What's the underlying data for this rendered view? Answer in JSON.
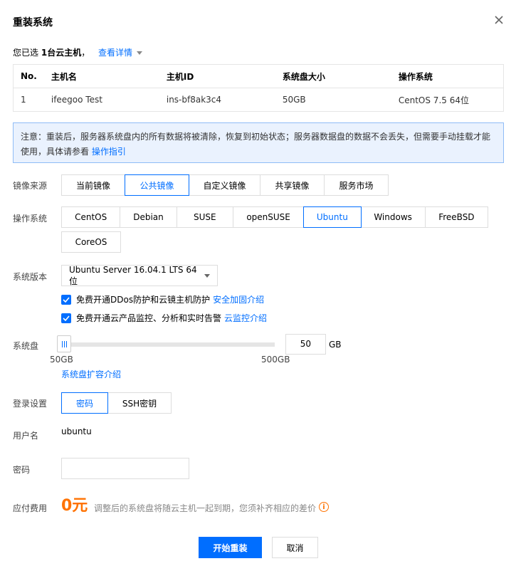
{
  "dialog": {
    "title": "重装系统",
    "close_icon": "close-icon"
  },
  "selection": {
    "prefix": "您已选",
    "count": "1台云主机",
    "separator": "，",
    "detail_link": "查看详情"
  },
  "table": {
    "headers": [
      "No.",
      "主机名",
      "主机ID",
      "系统盘大小",
      "操作系统"
    ],
    "rows": [
      [
        "1",
        "ifeegoo Test",
        "ins-bf8ak3c4",
        "50GB",
        "CentOS 7.5 64位"
      ]
    ]
  },
  "notice": {
    "text": "注意：重装后，服务器系统盘内的所有数据将被清除，恢复到初始状态；服务器数据盘的数据不会丢失，但需要手动挂载才能使用，具体请参看",
    "link": "操作指引"
  },
  "image_source": {
    "label": "镜像来源",
    "options": [
      "当前镜像",
      "公共镜像",
      "自定义镜像",
      "共享镜像",
      "服务市场"
    ],
    "selected": "公共镜像"
  },
  "os": {
    "label": "操作系统",
    "options_row1": [
      "CentOS",
      "Debian",
      "SUSE",
      "openSUSE",
      "Ubuntu",
      "Windows",
      "FreeBSD"
    ],
    "options_row2": [
      "CoreOS"
    ],
    "selected": "Ubuntu"
  },
  "version": {
    "label": "系统版本",
    "value": "Ubuntu Server 16.04.1 LTS 64位"
  },
  "checks": [
    {
      "text": "免费开通DDos防护和云镜主机防护",
      "link": "安全加固介绍",
      "checked": true
    },
    {
      "text": "免费开通云产品监控、分析和实时告警",
      "link": "云监控介绍",
      "checked": true
    }
  ],
  "disk": {
    "label": "系统盘",
    "min_label": "50GB",
    "max_label": "500GB",
    "value": "50",
    "unit": "GB",
    "level_fraction": 0,
    "link": "系统盘扩容介绍"
  },
  "login": {
    "label": "登录设置",
    "options": [
      "密码",
      "SSH密钥"
    ],
    "selected": "密码"
  },
  "username": {
    "label": "用户名",
    "value": "ubuntu"
  },
  "password": {
    "label": "密码",
    "value": ""
  },
  "fee": {
    "label": "应付费用",
    "amount": "0元",
    "note": "调整后的系统盘将随云主机一起到期，您须补齐相应的差价"
  },
  "buttons": {
    "primary": "开始重装",
    "cancel": "取消"
  },
  "colors": {
    "accent": "#006eff",
    "price": "#ff7200",
    "notice_bg": "#eaf2fe"
  }
}
